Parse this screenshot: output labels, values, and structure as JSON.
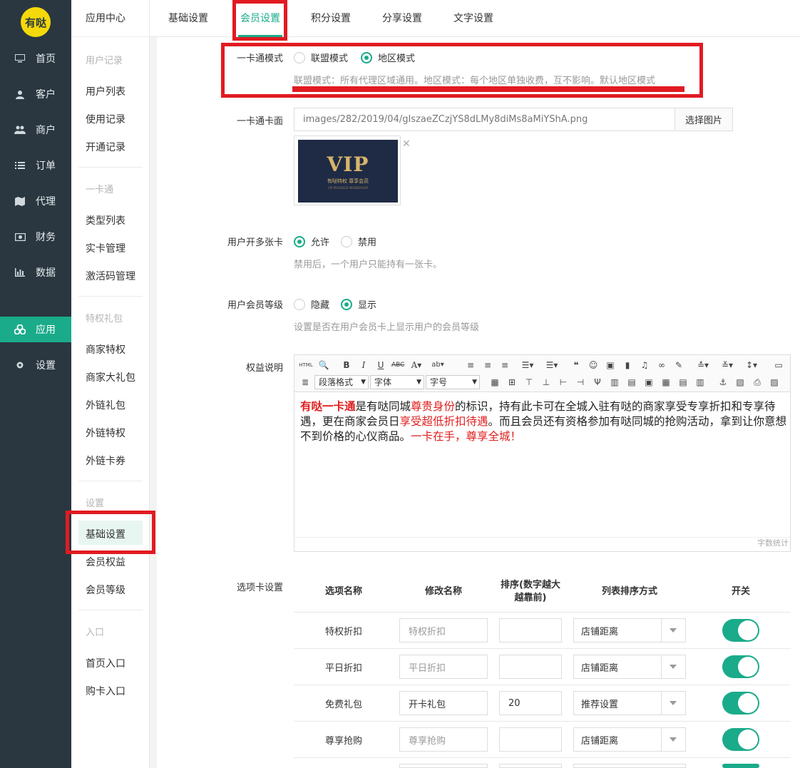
{
  "logo_text": "有哒",
  "main_nav": [
    {
      "label": "首页",
      "icon": "monitor-icon"
    },
    {
      "label": "客户",
      "icon": "user-icon"
    },
    {
      "label": "商户",
      "icon": "users-icon"
    },
    {
      "label": "订单",
      "icon": "list-icon"
    },
    {
      "label": "代理",
      "icon": "map-icon"
    },
    {
      "label": "财务",
      "icon": "money-icon"
    },
    {
      "label": "数据",
      "icon": "bar-chart-icon"
    },
    {
      "label": "应用",
      "icon": "cubes-icon",
      "active": true
    },
    {
      "label": "设置",
      "icon": "gear-icon"
    }
  ],
  "sub_nav": {
    "header": "应用中心",
    "groups": [
      {
        "title": "用户记录",
        "items": [
          "用户列表",
          "使用记录",
          "开通记录"
        ]
      },
      {
        "title": "一卡通",
        "items": [
          "类型列表",
          "实卡管理",
          "激活码管理"
        ]
      },
      {
        "title": "特权礼包",
        "items": [
          "商家特权",
          "商家大礼包",
          "外链礼包",
          "外链特权",
          "外链卡券"
        ]
      },
      {
        "title": "设置",
        "items": [
          "基础设置",
          "会员权益",
          "会员等级"
        ]
      },
      {
        "title": "入口",
        "items": [
          "首页入口",
          "购卡入口"
        ]
      }
    ]
  },
  "tabs": [
    "基础设置",
    "会员设置",
    "积分设置",
    "分享设置",
    "文字设置"
  ],
  "active_tab": "会员设置",
  "form": {
    "card_mode": {
      "label": "一卡通模式",
      "options": [
        "联盟模式",
        "地区模式"
      ],
      "selected": "地区模式",
      "hint": "联盟模式：所有代理区域通用。地区模式：每个地区单独收费，互不影响。默认地区模式"
    },
    "card_face": {
      "label": "一卡通卡面",
      "value": "images/282/2019/04/gIszaeZCzjYS8dLMy8diMs8aMiYShA.png",
      "button": "选择图片",
      "card_vip": "VIP",
      "card_sub": "有哒特权  尊享会员",
      "card_sub2": "VIP PRIVILEGE MEMBERSHIP"
    },
    "multi_card": {
      "label": "用户开多张卡",
      "options": [
        "允许",
        "禁用"
      ],
      "selected": "允许",
      "hint": "禁用后，一个用户只能持有一张卡。"
    },
    "member_level": {
      "label": "用户会员等级",
      "options": [
        "隐藏",
        "显示"
      ],
      "selected": "显示",
      "hint": "设置是否在用户会员卡上显示用户的会员等级"
    },
    "rights": {
      "label": "权益说明",
      "sel_paragraph": "段落格式",
      "sel_font": "字体",
      "sel_size": "字号",
      "content": {
        "p1_red_bold": "有哒一卡通",
        "p1_a": "是有哒同城",
        "p1_red": "尊贵身份",
        "p1_b": "的标识，持有此卡可在全城入驻有哒的商家享受专享折扣和专享待遇，更在商家会员日",
        "p1_red2": "享受超低折扣待遇",
        "p1_c": "。而且会员还有资格参加有哒同城的抢购活动，拿到让你意想不到价格的心仪商品。",
        "p1_red3": "一卡在手，尊享全城！"
      },
      "word_count": "字数统计"
    },
    "tab_settings": {
      "label": "选项卡设置",
      "headers": [
        "选项名称",
        "修改名称",
        "排序(数字越大越靠前)",
        "列表排序方式",
        "开关"
      ],
      "rows": [
        {
          "name": "特权折扣",
          "rename": "",
          "rename_placeholder": "特权折扣",
          "order": "",
          "sort": "店铺距离",
          "on": true
        },
        {
          "name": "平日折扣",
          "rename": "",
          "rename_placeholder": "平日折扣",
          "order": "",
          "sort": "店铺距离",
          "on": true
        },
        {
          "name": "免费礼包",
          "rename": "开卡礼包",
          "rename_placeholder": "",
          "order": "20",
          "sort": "推荐设置",
          "on": true
        },
        {
          "name": "尊享抢购",
          "rename": "",
          "rename_placeholder": "尊享抢购",
          "order": "",
          "sort": "店铺距离",
          "on": true
        }
      ]
    }
  },
  "colors": {
    "accent": "#1aab8a",
    "sidebar": "#2a3740",
    "highlight": "#e11b21"
  }
}
